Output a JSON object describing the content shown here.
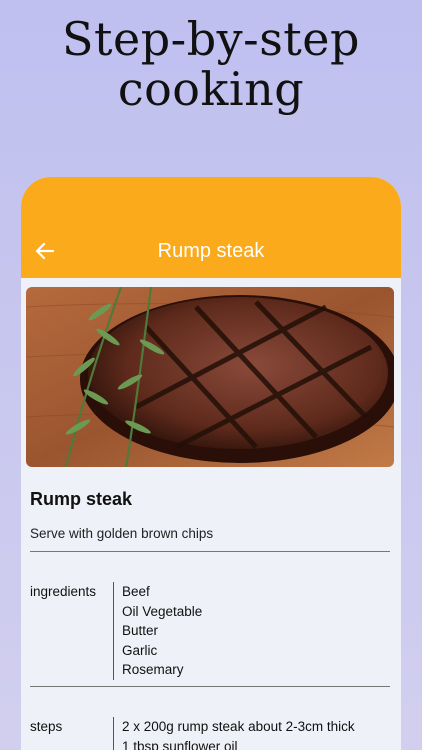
{
  "headline": {
    "line1": "Step-by-step",
    "line2": "cooking"
  },
  "appbar": {
    "title": "Rump steak",
    "back_icon": "arrow-left-icon",
    "color": "#fbaa1c"
  },
  "recipe": {
    "title": "Rump steak",
    "subtitle": "Serve with golden brown chips",
    "ingredients_label": "ingredients",
    "ingredients": [
      "Beef",
      "Oil Vegetable",
      "Butter",
      "Garlic",
      "Rosemary"
    ],
    "steps_label": "steps",
    "steps": [
      "2 x 200g rump steak about 2-3cm thick",
      "1 tbsp sunflower oil"
    ]
  }
}
